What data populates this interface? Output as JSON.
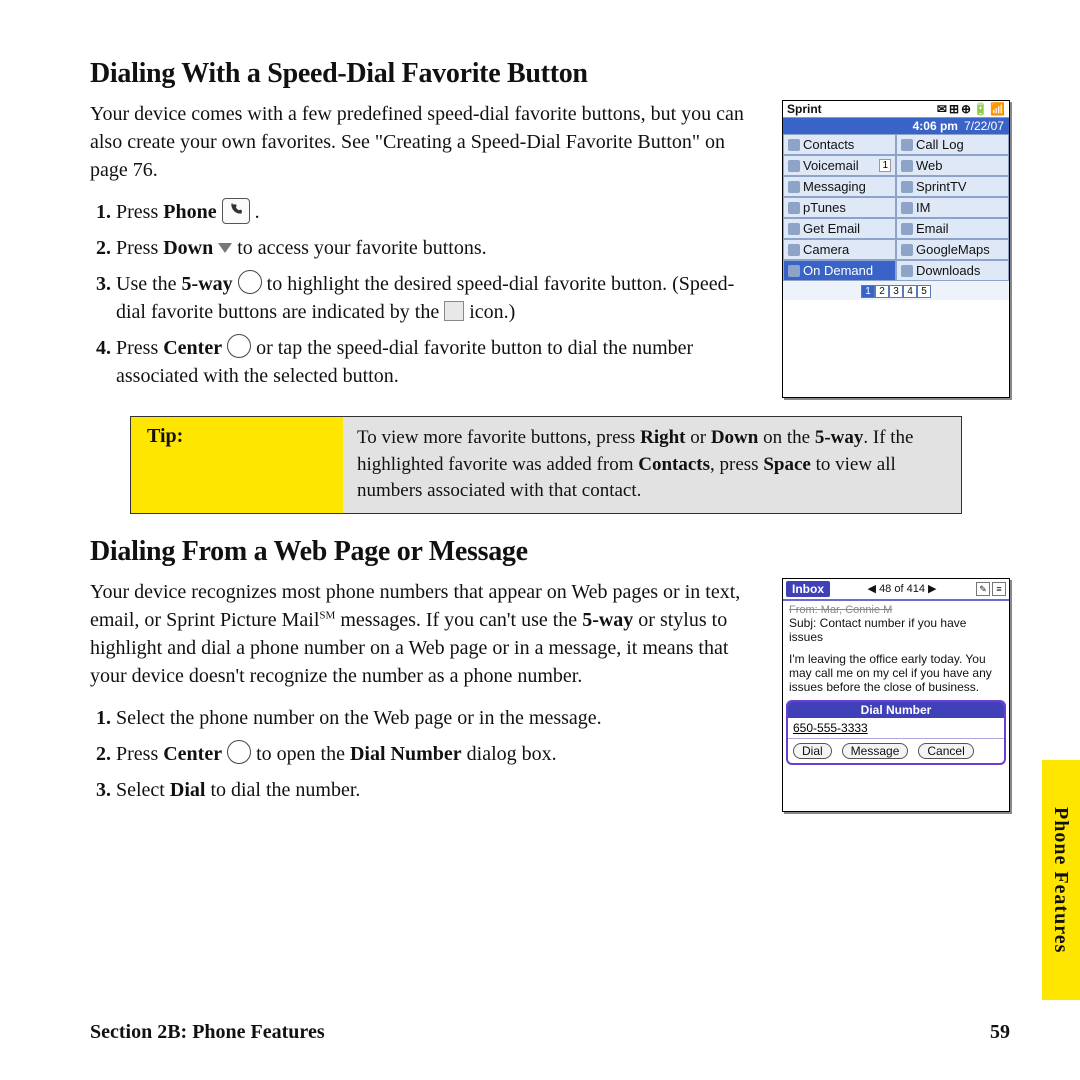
{
  "headings": {
    "h1": "Dialing With a Speed-Dial Favorite Button",
    "h2": "Dialing From a Web Page or Message"
  },
  "intro1": "Your device comes with a few predefined speed-dial favorite buttons, but you can also create your own favorites. See \"Creating a Speed-Dial Favorite Button\" on page 76.",
  "steps1": {
    "s1a": "Press ",
    "s1b": "Phone",
    "s1c": ".",
    "s2a": "Press ",
    "s2b": "Down",
    "s2c": " to access your favorite buttons.",
    "s3a": "Use the ",
    "s3b": "5-way",
    "s3c": " to highlight the desired speed-dial favorite button. (Speed-dial favorite buttons are indicated by the ",
    "s3d": " icon.)",
    "s4a": "Press ",
    "s4b": "Center",
    "s4c": " or tap the speed-dial favorite button to dial the number associated with the selected button."
  },
  "tip": {
    "label": "Tip:",
    "t1": "To view more favorite buttons, press ",
    "t2": "Right",
    "t3": " or ",
    "t4": "Down",
    "t5": " on the ",
    "t6": "5-way",
    "t7": ". If the highlighted favorite was added from ",
    "t8": "Contacts",
    "t9": ", press ",
    "t10": "Space",
    "t11": " to view all numbers associated with that contact."
  },
  "intro2a": "Your device recognizes most phone numbers that appear on Web pages or in text, email, or Sprint Picture Mail",
  "intro2sm": "SM",
  "intro2b": " messages. If you can't use the ",
  "intro2bold": "5-way",
  "intro2c": " or stylus to highlight and dial a phone number on a Web page or in a message, it means that your device doesn't recognize the number as a phone number.",
  "steps2": {
    "s1": "Select the phone number on the Web page or in the message.",
    "s2a": "Press ",
    "s2b": "Center",
    "s2c": " to open the ",
    "s2d": "Dial Number",
    "s2e": " dialog box.",
    "s3a": "Select ",
    "s3b": "Dial",
    "s3c": " to dial the number."
  },
  "shot1": {
    "carrier": "Sprint",
    "time": "4:06 pm",
    "date": "7/22/07",
    "rows": [
      [
        "Contacts",
        "Call Log"
      ],
      [
        "Voicemail",
        "Web"
      ],
      [
        "Messaging",
        "SprintTV"
      ],
      [
        "pTunes",
        "IM"
      ],
      [
        "Get Email",
        "Email"
      ],
      [
        "Camera",
        "GoogleMaps"
      ],
      [
        "On Demand",
        "Downloads"
      ]
    ],
    "vm_count": "1",
    "pager": [
      "1",
      "2",
      "3",
      "4",
      "5"
    ]
  },
  "shot2": {
    "inbox": "Inbox",
    "count": "48 of 414",
    "from": "From: Mar, Connie M",
    "subj": "Subj: Contact number if you have issues",
    "body": "I'm leaving the office early today. You may call me on my cel if you have any issues before the close of business.",
    "dial_title": "Dial Number",
    "dial_num": "650-555-3333",
    "btn_dial": "Dial",
    "btn_msg": "Message",
    "btn_cancel": "Cancel"
  },
  "footer": {
    "section": "Section 2B: Phone Features",
    "page": "59",
    "tab": "Phone Features"
  }
}
